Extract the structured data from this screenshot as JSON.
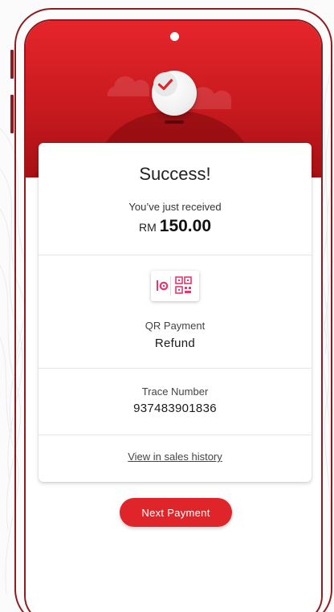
{
  "brand": {
    "accent": "#e0252a",
    "hero_top": "#e5262b",
    "hero_bottom": "#a61014",
    "frame": "#8e1b1f"
  },
  "status": {
    "icon": "check-icon",
    "title": "Success!",
    "subtitle": "You’ve just received"
  },
  "amount": {
    "currency": "RM",
    "value": "150.00"
  },
  "payment": {
    "icon": "qr-payment-icon",
    "method": "QR Payment",
    "type": "Refund"
  },
  "trace": {
    "label": "Trace Number",
    "value": "937483901836"
  },
  "links": {
    "sales_history": "View in sales history"
  },
  "actions": {
    "next_payment": "Next Payment"
  }
}
